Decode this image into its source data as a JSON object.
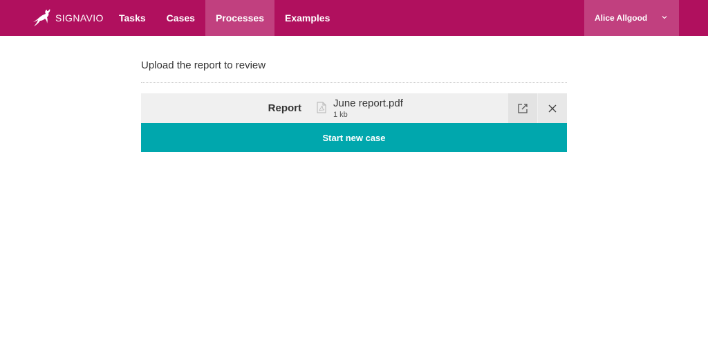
{
  "brand": {
    "name": "SIGNAVIO",
    "logo_icon": "gazelle-logo-icon"
  },
  "nav": {
    "items": [
      {
        "label": "Tasks",
        "active": false
      },
      {
        "label": "Cases",
        "active": false
      },
      {
        "label": "Processes",
        "active": true
      },
      {
        "label": "Examples",
        "active": false
      }
    ]
  },
  "user": {
    "name": "Alice Allgood",
    "menu_icon": "chevron-down-icon"
  },
  "form": {
    "title": "Upload the report to review",
    "field_label": "Report",
    "file": {
      "name": "June report.pdf",
      "size": "1 kb",
      "icon": "pdf-file-icon"
    },
    "open_icon": "external-link-icon",
    "remove_icon": "close-icon",
    "submit_label": "Start new case"
  },
  "colors": {
    "navbar": "#b0105e",
    "nav_active": "#c1407f",
    "primary_button": "#00a7ad",
    "field_background": "#f0f0f0"
  }
}
